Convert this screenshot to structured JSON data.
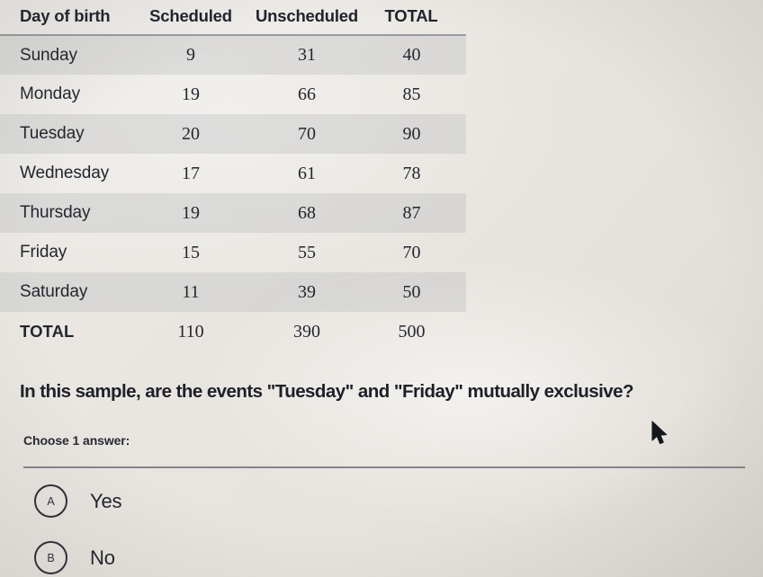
{
  "table": {
    "headers": [
      "Day of birth",
      "Scheduled",
      "Unscheduled",
      "TOTAL"
    ],
    "rows": [
      {
        "day": "Sunday",
        "scheduled": "9",
        "unscheduled": "31",
        "total": "40"
      },
      {
        "day": "Monday",
        "scheduled": "19",
        "unscheduled": "66",
        "total": "85"
      },
      {
        "day": "Tuesday",
        "scheduled": "20",
        "unscheduled": "70",
        "total": "90"
      },
      {
        "day": "Wednesday",
        "scheduled": "17",
        "unscheduled": "61",
        "total": "78"
      },
      {
        "day": "Thursday",
        "scheduled": "19",
        "unscheduled": "68",
        "total": "87"
      },
      {
        "day": "Friday",
        "scheduled": "15",
        "unscheduled": "55",
        "total": "70"
      },
      {
        "day": "Saturday",
        "scheduled": "11",
        "unscheduled": "39",
        "total": "50"
      },
      {
        "day": "TOTAL",
        "scheduled": "110",
        "unscheduled": "390",
        "total": "500"
      }
    ]
  },
  "question": {
    "prompt": "In this sample, are the events \"Tuesday\" and \"Friday\" mutually exclusive?",
    "choose_label": "Choose 1 answer:",
    "options": [
      {
        "letter": "A",
        "label": "Yes"
      },
      {
        "letter": "B",
        "label": "No"
      }
    ]
  },
  "cursor": {
    "icon": "mouse-pointer-icon"
  },
  "colors": {
    "page_background": "#e9e6e1",
    "stripe": "#afb2b6",
    "text": "#1f222a",
    "divider": "#84858a",
    "header_rule": "#9a9aa0"
  }
}
